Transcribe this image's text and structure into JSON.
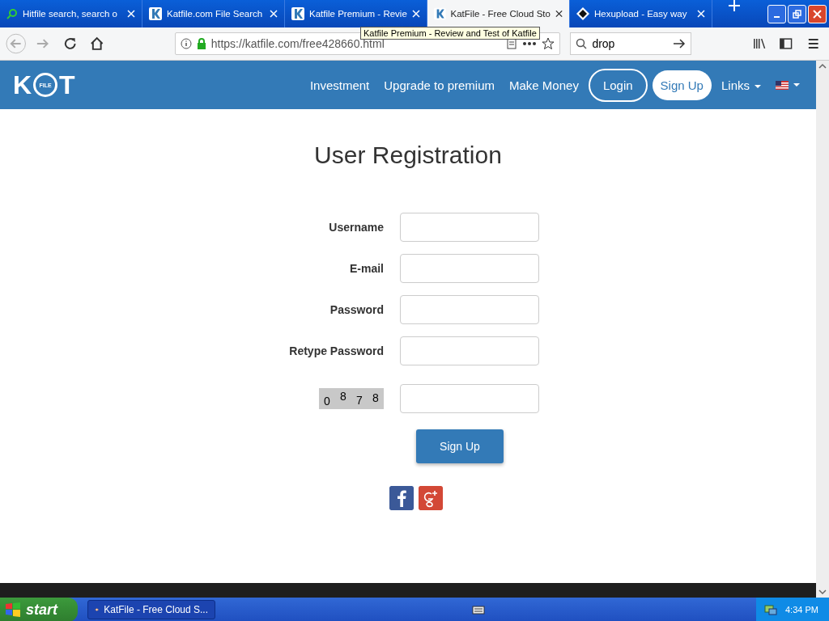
{
  "browser": {
    "tabs": [
      {
        "title": "Hitfile search, search o",
        "selected": false
      },
      {
        "title": "Katfile.com File Search",
        "selected": false
      },
      {
        "title": "Katfile Premium - Revie",
        "selected": false
      },
      {
        "title": "KatFile - Free Cloud Sto",
        "selected": true
      },
      {
        "title": "Hexupload - Easy way",
        "selected": false
      }
    ],
    "url": "https://katfile.com/free428660.html",
    "search": "drop",
    "tooltip": "Katfile Premium - Review and Test of Katfile"
  },
  "site": {
    "logo": {
      "left": "K",
      "badge": "FILE",
      "right": "T"
    },
    "nav": [
      {
        "label": "Investment",
        "kind": "link"
      },
      {
        "label": "Upgrade to premium",
        "kind": "link"
      },
      {
        "label": "Make Money",
        "kind": "link"
      },
      {
        "label": "Login",
        "kind": "outline"
      },
      {
        "label": "Sign Up",
        "kind": "solid"
      },
      {
        "label": "Links",
        "kind": "dropdown"
      },
      {
        "kind": "flag"
      }
    ]
  },
  "form": {
    "title": "User Registration",
    "fields": [
      {
        "label": "Username"
      },
      {
        "label": "E-mail"
      },
      {
        "label": "Password"
      },
      {
        "label": "Retype Password"
      }
    ],
    "captcha": [
      "0",
      "8",
      "7",
      "8"
    ],
    "submit": "Sign Up"
  },
  "taskbar": {
    "start": "start",
    "window": "KatFile - Free Cloud S...",
    "clock": "4:34 PM"
  }
}
